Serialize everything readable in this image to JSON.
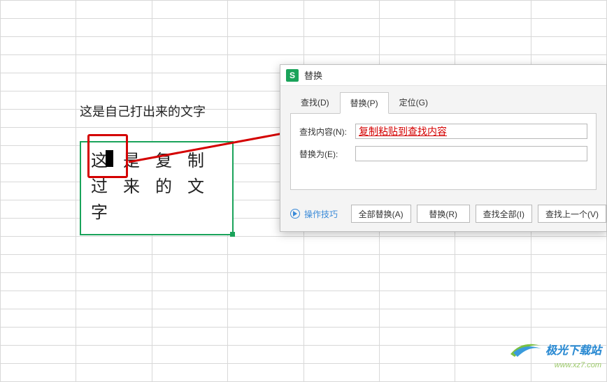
{
  "sheet": {
    "label_cell_text": "这是自己打出来的文字",
    "merged_line1": "这是复制",
    "merged_line1_part1": "这",
    "merged_line1_part2": "是复制",
    "merged_line2": "过来的文",
    "merged_line3": "字"
  },
  "annotation": {
    "arrow_color": "#d40000"
  },
  "dialog": {
    "app_icon_letter": "S",
    "title": "替换",
    "tabs": {
      "find": "查找(D)",
      "replace": "替换(P)",
      "goto": "定位(G)"
    },
    "find_label": "查找内容(N):",
    "find_value": "复制粘贴到查找内容",
    "replace_label": "替换为(E):",
    "replace_value": "",
    "tips_label": "操作技巧",
    "buttons": {
      "replace_all": "全部替换(A)",
      "replace": "替换(R)",
      "find_all": "查找全部(I)",
      "find_prev": "查找上一个(V)"
    }
  },
  "watermark": {
    "brand": "极光下载站",
    "url": "www.xz7.com"
  }
}
